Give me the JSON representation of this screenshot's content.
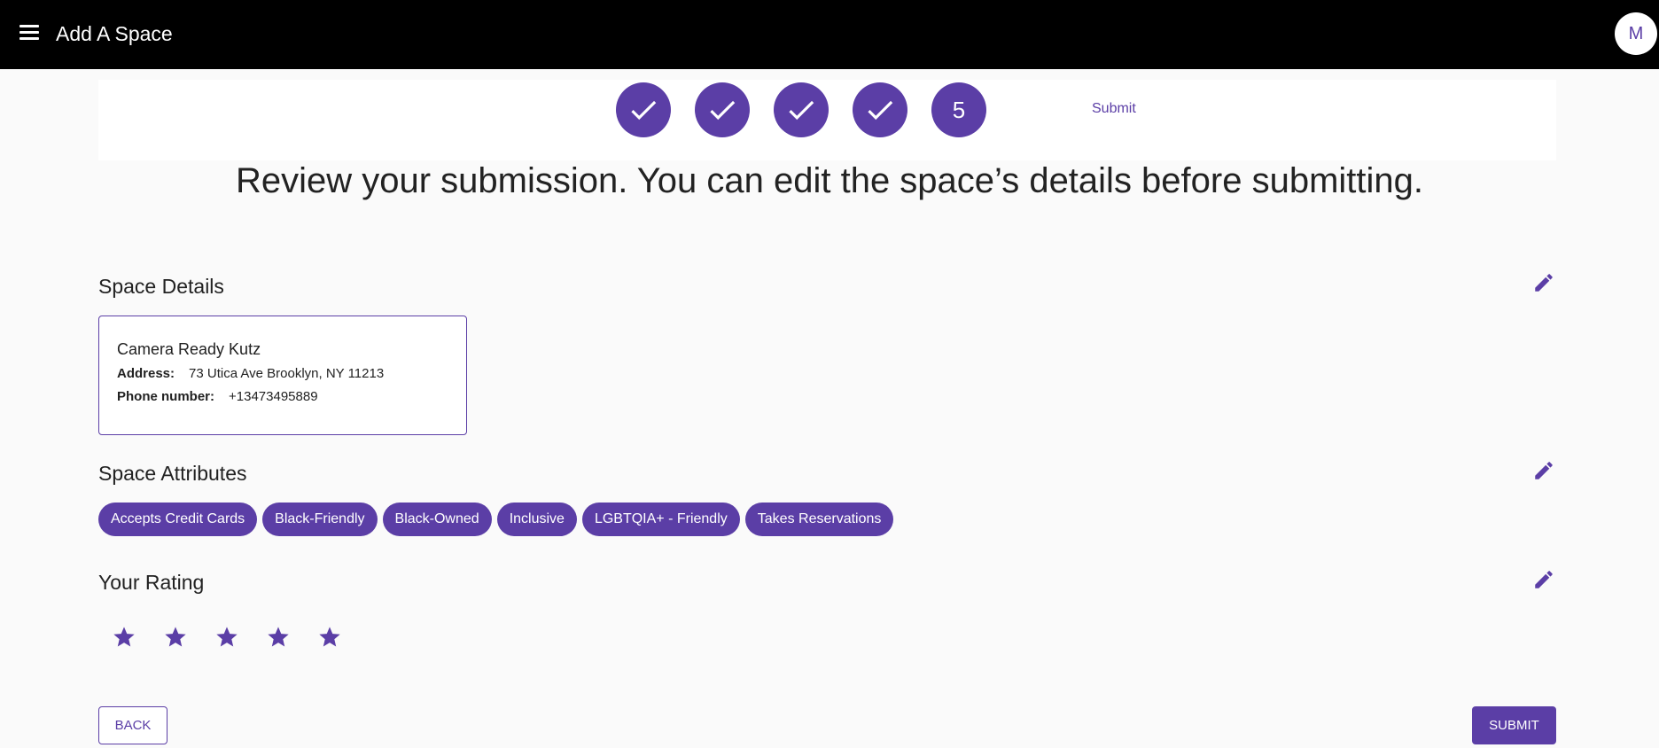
{
  "appbar": {
    "title": "Add A Space",
    "menu_icon": "hamburger-menu-icon",
    "avatar_initial": "M"
  },
  "stepper": {
    "steps": [
      {
        "state": "complete",
        "icon": "check-icon"
      },
      {
        "state": "complete",
        "icon": "check-icon"
      },
      {
        "state": "complete",
        "icon": "check-icon"
      },
      {
        "state": "complete",
        "icon": "check-icon"
      },
      {
        "state": "active",
        "number": "5"
      }
    ],
    "active_label": "Submit"
  },
  "page": {
    "heading": "Review your submission. You can edit the space’s details before submitting."
  },
  "space_details": {
    "title": "Space Details",
    "edit_icon": "pencil-icon",
    "name": "Camera Ready Kutz",
    "address_label": "Address:",
    "address": "73 Utica Ave Brooklyn, NY 11213",
    "phone_label": "Phone number:",
    "phone": "+13473495889"
  },
  "space_attributes": {
    "title": "Space Attributes",
    "edit_icon": "pencil-icon",
    "chips": [
      "Accepts Credit Cards",
      "Black-Friendly",
      "Black-Owned",
      "Inclusive",
      "LGBTQIA+ - Friendly",
      "Takes Reservations"
    ]
  },
  "rating": {
    "title": "Your Rating",
    "edit_icon": "pencil-icon",
    "value": 5,
    "max": 5
  },
  "actions": {
    "back_label": "BACK",
    "submit_label": "SUBMIT"
  },
  "colors": {
    "accent": "#5b3ea6",
    "appbar": "#000000",
    "background": "#fafafa"
  }
}
